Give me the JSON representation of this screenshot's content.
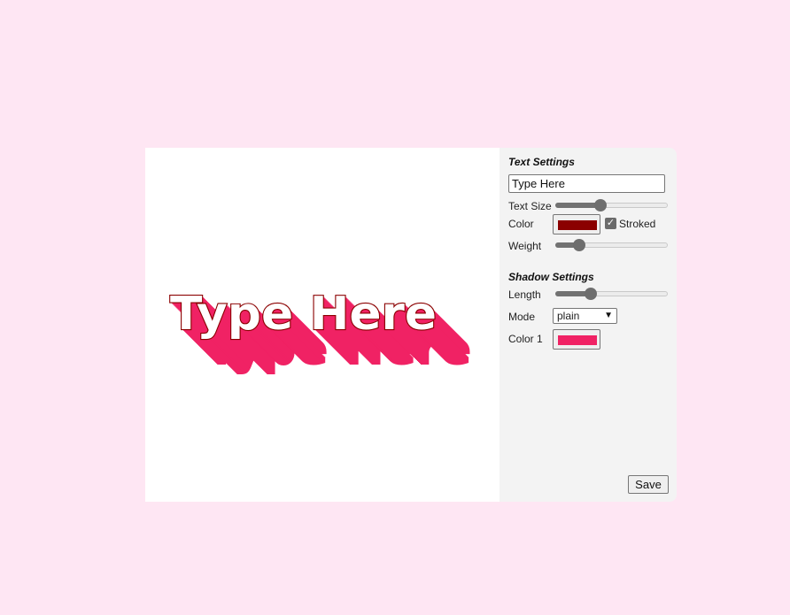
{
  "canvas": {
    "text": "Type Here",
    "text_color": "#ffffff",
    "stroke_color": "#8b0000",
    "shadow_color": "#f02264"
  },
  "panel": {
    "text_settings": {
      "title": "Text Settings",
      "text_value": "Type Here",
      "size_label": "Text Size",
      "size_level": 0.39,
      "color_label": "Color",
      "color": "#8b0000",
      "stroked_label": "Stroked",
      "stroked_checked": true,
      "weight_label": "Weight",
      "weight_level": 0.18
    },
    "shadow_settings": {
      "title": "Shadow Settings",
      "length_label": "Length",
      "length_level": 0.29,
      "mode_label": "Mode",
      "mode_value": "plain",
      "color1_label": "Color 1",
      "color1": "#f02264"
    },
    "save_label": "Save"
  }
}
